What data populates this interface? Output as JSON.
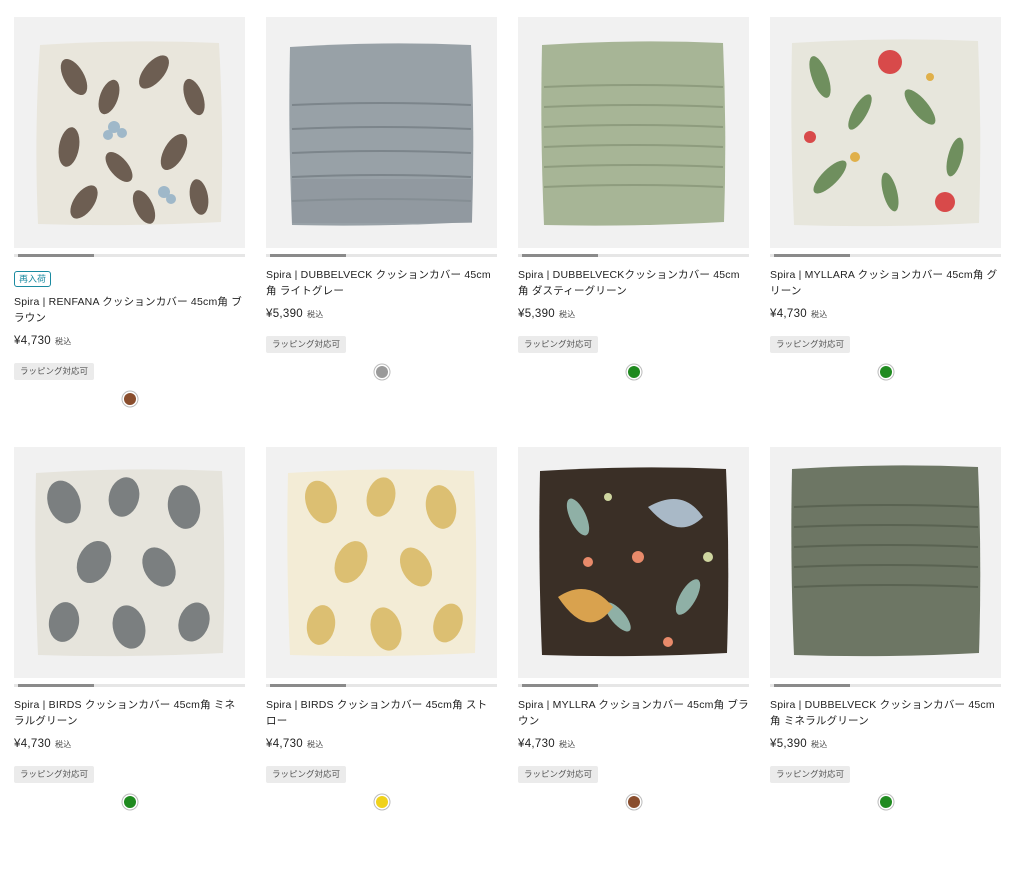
{
  "products": [
    {
      "badge": "再入荷",
      "title": "Spira | RENFANA クッションカバー 45cm角 ブラウン",
      "price": "¥4,730",
      "tax": "税込",
      "tag": "ラッピング対応可",
      "swatch": "#8a4e2e",
      "pattern": "leaves-brown"
    },
    {
      "title": "Spira | DUBBELVECK クッションカバー 45cm角 ライトグレー",
      "price": "¥5,390",
      "tax": "税込",
      "tag": "ラッピング対応可",
      "swatch": "#9a9a9a",
      "pattern": "pleat-gray"
    },
    {
      "title": "Spira | DUBBELVECKクッションカバー 45cm角 ダスティーグリーン",
      "price": "¥5,390",
      "tax": "税込",
      "tag": "ラッピング対応可",
      "swatch": "#1f8a1f",
      "pattern": "pleat-green"
    },
    {
      "title": "Spira | MYLLARA クッションカバー 45cm角 グリーン",
      "price": "¥4,730",
      "tax": "税込",
      "tag": "ラッピング対応可",
      "swatch": "#1f8a1f",
      "pattern": "floral-light"
    },
    {
      "title": "Spira | BIRDS クッションカバー 45cm角 ミネラルグリーン",
      "price": "¥4,730",
      "tax": "税込",
      "tag": "ラッピング対応可",
      "swatch": "#1f8a1f",
      "pattern": "birds-gray"
    },
    {
      "title": "Spira | BIRDS クッションカバー 45cm角 ストロー",
      "price": "¥4,730",
      "tax": "税込",
      "tag": "ラッピング対応可",
      "swatch": "#f0d21c",
      "pattern": "birds-yellow"
    },
    {
      "title": "Spira | MYLLRA クッションカバー 45cm角 ブラウン",
      "price": "¥4,730",
      "tax": "税込",
      "tag": "ラッピング対応可",
      "swatch": "#8a4e2e",
      "pattern": "floral-dark"
    },
    {
      "title": "Spira | DUBBELVECK クッションカバー 45cm角 ミネラルグリーン",
      "price": "¥5,390",
      "tax": "税込",
      "tag": "ラッピング対応可",
      "swatch": "#1f8a1f",
      "pattern": "pleat-darkgreen"
    }
  ]
}
